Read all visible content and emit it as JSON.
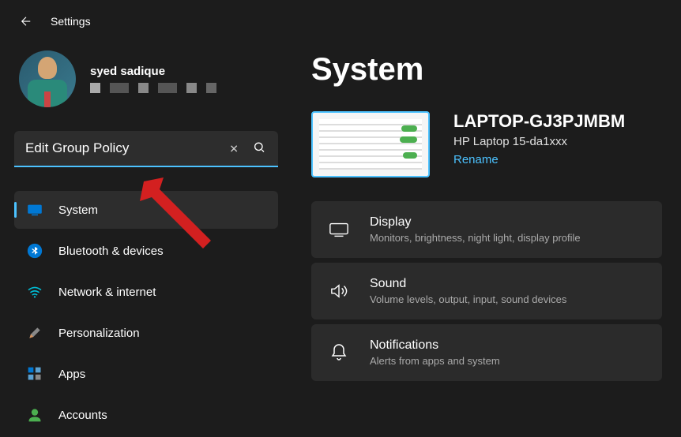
{
  "app": {
    "title": "Settings"
  },
  "profile": {
    "name": "syed sadique"
  },
  "search": {
    "value": "Edit Group Policy"
  },
  "sidebar": {
    "items": [
      {
        "label": "System"
      },
      {
        "label": "Bluetooth & devices"
      },
      {
        "label": "Network & internet"
      },
      {
        "label": "Personalization"
      },
      {
        "label": "Apps"
      },
      {
        "label": "Accounts"
      }
    ]
  },
  "page": {
    "title": "System"
  },
  "device": {
    "name": "LAPTOP-GJ3PJMBM",
    "model": "HP Laptop 15-da1xxx",
    "rename": "Rename"
  },
  "cards": [
    {
      "title": "Display",
      "sub": "Monitors, brightness, night light, display profile"
    },
    {
      "title": "Sound",
      "sub": "Volume levels, output, input, sound devices"
    },
    {
      "title": "Notifications",
      "sub": "Alerts from apps and system"
    }
  ]
}
